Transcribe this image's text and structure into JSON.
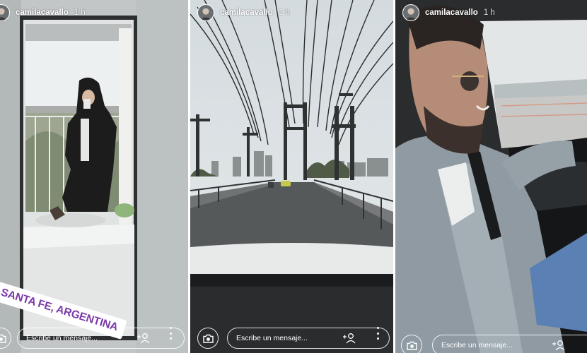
{
  "stories": [
    {
      "username": "camilacavallo",
      "time": "1 h",
      "sticker": "SANTA FE, ARGENTINA",
      "placeholder": "Escribe un mensaje...",
      "photo": "mirror-selfie-bedroom"
    },
    {
      "username": "camilacavallo",
      "time": "1 h",
      "placeholder": "Escribe un mensaje...",
      "photo": "suspension-bridge-road"
    },
    {
      "username": "camilacavallo",
      "time": "1 h",
      "placeholder": "Escribe un mensaje...",
      "photo": "man-driving-car"
    }
  ],
  "icons": [
    "avatar",
    "camera-icon",
    "add-friend-icon",
    "more-options-icon"
  ],
  "colors": {
    "sticker_text": "#7a3aa8",
    "sticker_bg": "#ffffff",
    "ui_text": "#ffffff"
  }
}
